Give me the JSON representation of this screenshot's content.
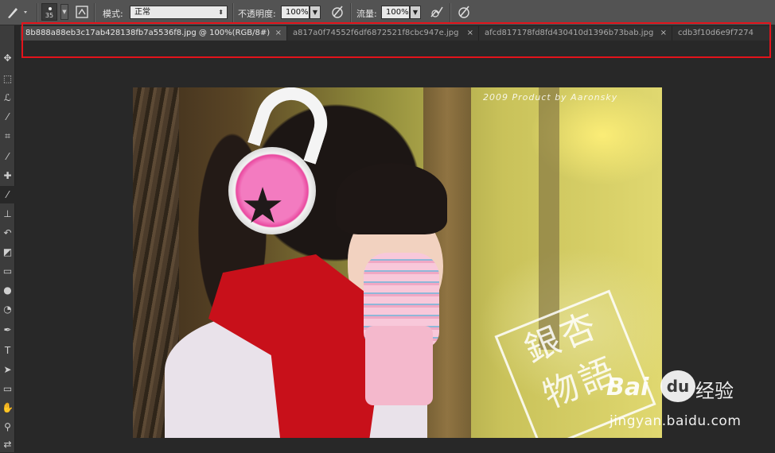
{
  "options_bar": {
    "brush_size": "35",
    "mode_label": "模式:",
    "mode_value": "正常",
    "opacity_label": "不透明度:",
    "opacity_value": "100%",
    "flow_label": "流量:",
    "flow_value": "100%"
  },
  "tabs": [
    {
      "label": "8b888a88eb3c17ab428138fb7a5536f8.jpg @ 100%(RGB/8#)",
      "close": "×",
      "active": true
    },
    {
      "label": "a817a0f74552f6df6872521f8cbc947e.jpg",
      "close": "×",
      "active": false
    },
    {
      "label": "afcd817178fd8fd430410d1396b73bab.jpg",
      "close": "×",
      "active": false
    },
    {
      "label": "cdb3f10d6e9f7274",
      "close": "",
      "active": false
    }
  ],
  "tools": [
    {
      "name": "move-tool",
      "glyph": "✥"
    },
    {
      "name": "marquee-tool",
      "glyph": "⬚"
    },
    {
      "name": "lasso-tool",
      "glyph": "ℒ"
    },
    {
      "name": "quick-select-tool",
      "glyph": "⁄"
    },
    {
      "name": "crop-tool",
      "glyph": "⌗"
    },
    {
      "name": "eyedropper-tool",
      "glyph": "⁄"
    },
    {
      "name": "healing-brush-tool",
      "glyph": "✚"
    },
    {
      "name": "brush-tool",
      "glyph": "⁄"
    },
    {
      "name": "clone-stamp-tool",
      "glyph": "⊥"
    },
    {
      "name": "history-brush-tool",
      "glyph": "↶"
    },
    {
      "name": "eraser-tool",
      "glyph": "◩"
    },
    {
      "name": "gradient-tool",
      "glyph": "▭"
    },
    {
      "name": "blur-tool",
      "glyph": "●"
    },
    {
      "name": "dodge-tool",
      "glyph": "◔"
    },
    {
      "name": "pen-tool",
      "glyph": "✒"
    },
    {
      "name": "type-tool",
      "glyph": "T"
    },
    {
      "name": "path-select-tool",
      "glyph": "➤"
    },
    {
      "name": "shape-tool",
      "glyph": "▭"
    },
    {
      "name": "hand-tool",
      "glyph": "✋"
    },
    {
      "name": "zoom-tool",
      "glyph": "⚲"
    },
    {
      "name": "swap-colors",
      "glyph": "⇄"
    }
  ],
  "photo": {
    "copyright": "2009 Product by Aaronsky",
    "stamp_line1": "銀杏",
    "stamp_line2": "物語"
  },
  "watermark": {
    "brand_left": "Bai",
    "paw": "du",
    "brand_right": "经验",
    "site": "jingyan.baidu.com"
  },
  "colors": {
    "highlight": "#e3131b",
    "options_bar": "#535353",
    "workspace": "#282828"
  }
}
